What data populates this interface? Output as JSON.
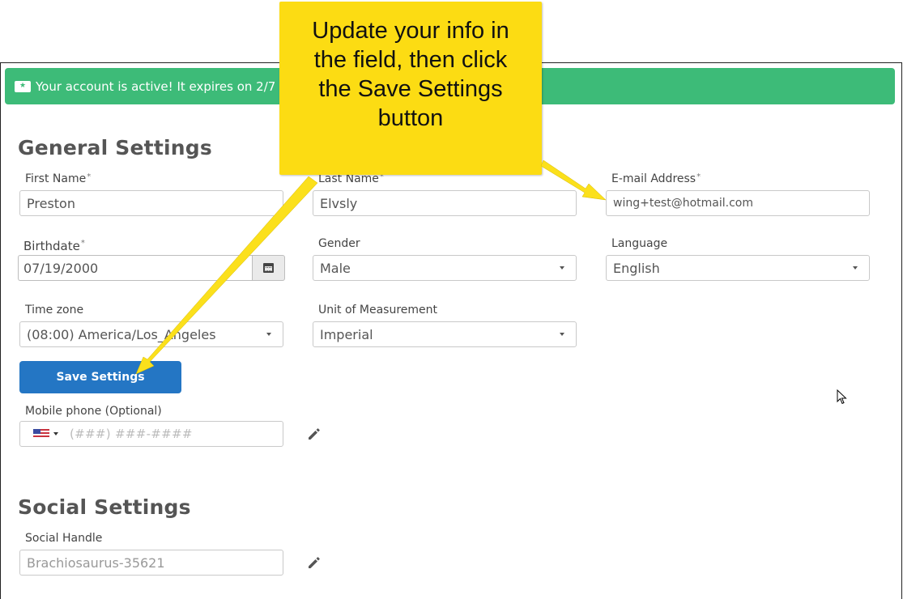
{
  "alert": {
    "text": "Your account is active! It expires on 2/7",
    "icon": "ticket-star-icon",
    "color": "#3dbb78"
  },
  "callout": {
    "text": "Update your info in the field, then click the Save Settings button",
    "color": "#fcdc13"
  },
  "general": {
    "title": "General Settings",
    "first_name": {
      "label": "First Name",
      "required": "*",
      "value": "Preston"
    },
    "last_name": {
      "label": "Last Name",
      "required": "*",
      "value": "Elvsly"
    },
    "email": {
      "label": "E-mail Address",
      "required": "*",
      "value": "wing+test@hotmail.com"
    },
    "birthdate": {
      "label": "Birthdate",
      "required": "*",
      "value": "07/19/2000",
      "icon": "calendar-icon"
    },
    "gender": {
      "label": "Gender",
      "value": "Male"
    },
    "language": {
      "label": "Language",
      "value": "English"
    },
    "timezone": {
      "label": "Time zone",
      "value": "(08:00) America/Los_Angeles"
    },
    "unit": {
      "label": "Unit of Measurement",
      "value": "Imperial"
    },
    "save_label": "Save Settings",
    "save_color": "#2476c4",
    "phone": {
      "label": "Mobile phone (Optional)",
      "placeholder": "(###) ###-####",
      "country_icon": "us-flag-icon",
      "edit_icon": "pencil-icon"
    }
  },
  "social": {
    "title": "Social Settings",
    "handle": {
      "label": "Social Handle",
      "value": "Brachiosaurus-35621",
      "edit_icon": "pencil-icon"
    }
  }
}
